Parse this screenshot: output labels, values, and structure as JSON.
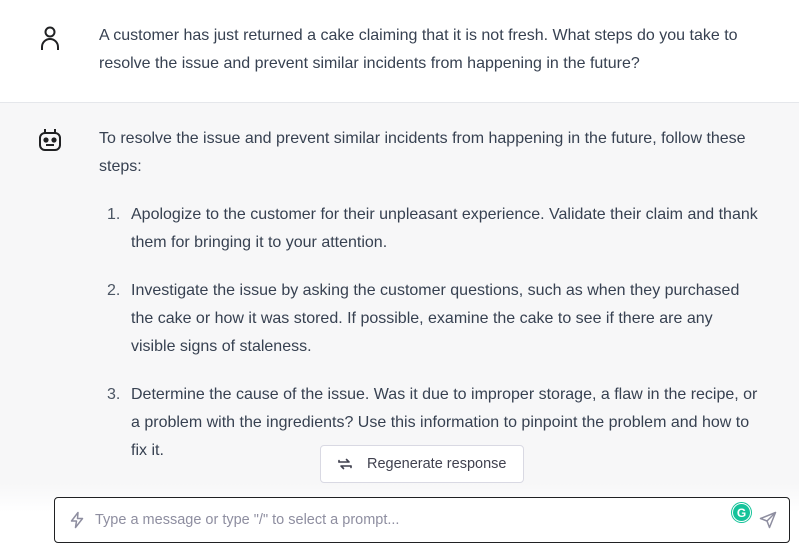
{
  "user_message": {
    "avatar_icon": "user-icon",
    "text": "A customer has just returned a cake claiming that it is not fresh. What steps do you take to resolve the issue and prevent similar incidents from happening in the future?"
  },
  "bot_message": {
    "avatar_icon": "bot-icon",
    "intro": "To resolve the issue and prevent similar incidents from happening in the future, follow these steps:",
    "steps": [
      {
        "num": "1.",
        "text": "Apologize to the customer for their unpleasant experience. Validate their claim and thank them for bringing it to your attention."
      },
      {
        "num": "2.",
        "text": "Investigate the issue by asking the customer questions, such as when they purchased the cake or how it was stored. If possible, examine the cake to see if there are any visible signs of staleness."
      },
      {
        "num": "3.",
        "text": "Determine the cause of the issue. Was it due to improper storage, a flaw in the recipe, or a problem with the ingredients? Use this information to pinpoint the problem and how to fix it."
      }
    ]
  },
  "regenerate": {
    "label": "Regenerate response",
    "icon": "refresh-icon"
  },
  "composer": {
    "placeholder": "Type a message or type \"/\" to select a prompt...",
    "prompt_icon": "bolt-icon",
    "grammarly_letter": "G",
    "send_icon": "send-icon"
  },
  "colors": {
    "bot_background": "#f7f7f8",
    "text": "#374151",
    "grammarly": "#15c39a"
  }
}
